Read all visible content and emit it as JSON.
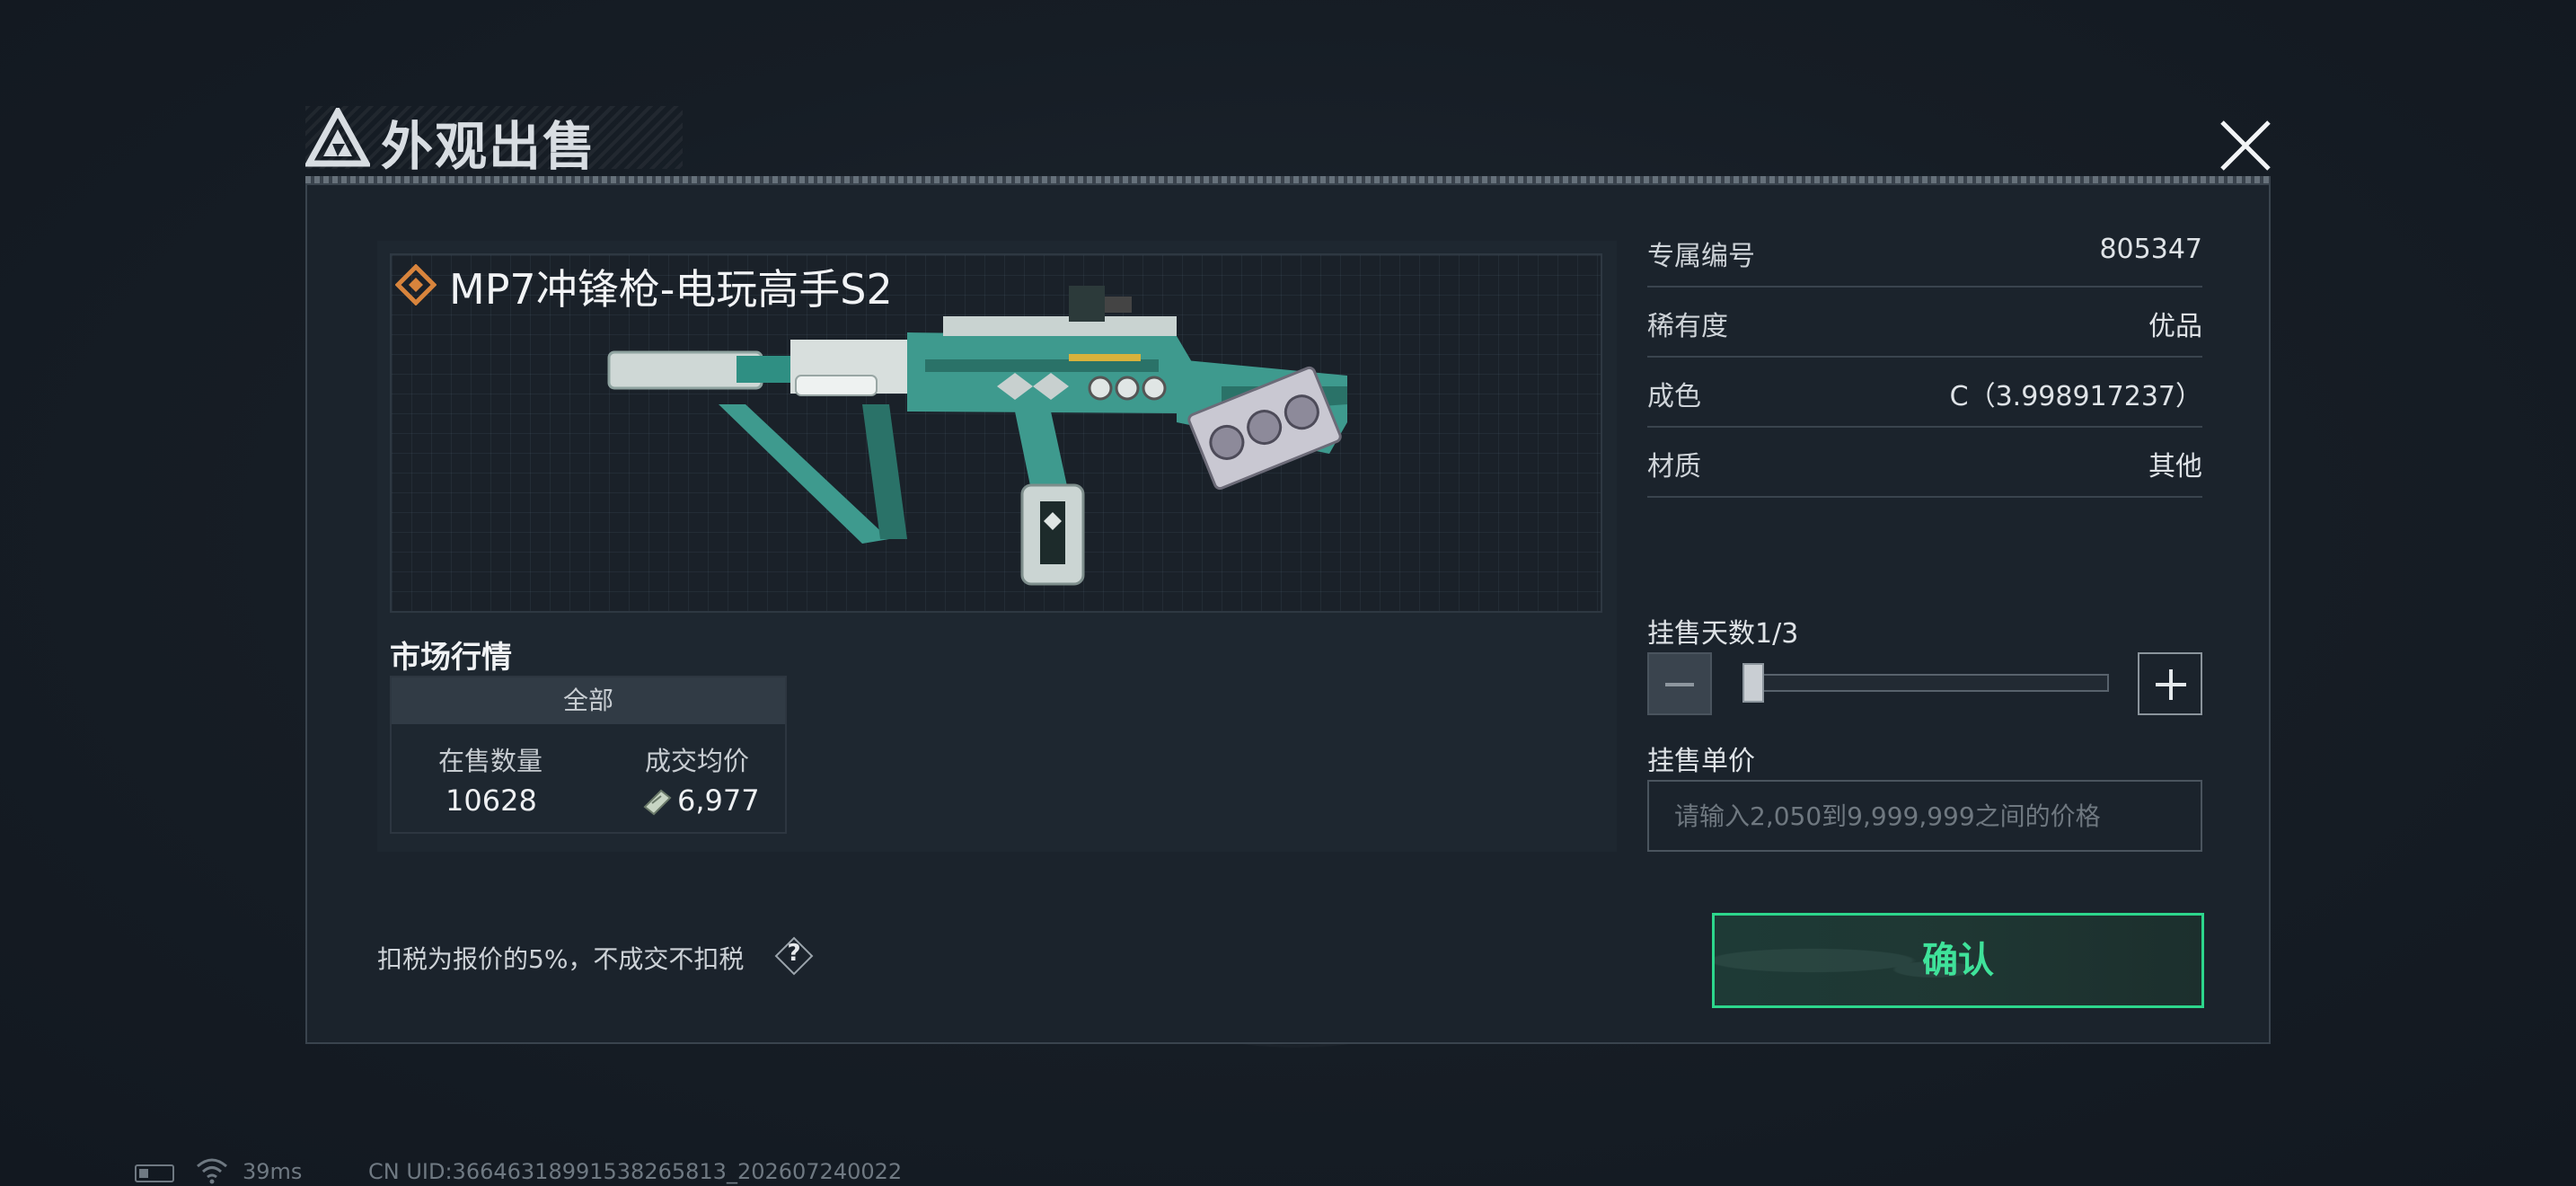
{
  "dialog": {
    "title": "外观出售",
    "close_icon": "close-icon"
  },
  "item": {
    "rarity_icon": "diamond-rarity-icon",
    "name": "MP7冲锋枪-电玩高手S2"
  },
  "market": {
    "title": "市场行情",
    "tab": "全部",
    "col1_header": "在售数量",
    "col1_value": "10628",
    "col2_header": "成交均价",
    "currency_icon": "currency-icon",
    "col2_value": "6,977"
  },
  "info": [
    {
      "label": "专属编号",
      "value": "805347"
    },
    {
      "label": "稀有度",
      "value": "优品"
    },
    {
      "label": "成色",
      "value": "C（3.998917237）"
    },
    {
      "label": "材质",
      "value": "其他"
    }
  ],
  "listing": {
    "days_label": "挂售天数1/3",
    "days_current": 1,
    "days_max": 3,
    "price_label": "挂售单价",
    "price_placeholder": "请输入2,050到9,999,999之间的价格",
    "price_value": ""
  },
  "footer": {
    "tax_note": "扣税为报价的5%，不成交不扣税",
    "help_label": "?",
    "confirm_label": "确认"
  },
  "status_bar": {
    "ping": "39ms",
    "uid": "CN UID:36646318991538265813_202607240022"
  },
  "colors": {
    "accent_green": "#2dd68c",
    "rarity_orange": "#d8843c",
    "weapon_teal": "#3e9a8e"
  }
}
